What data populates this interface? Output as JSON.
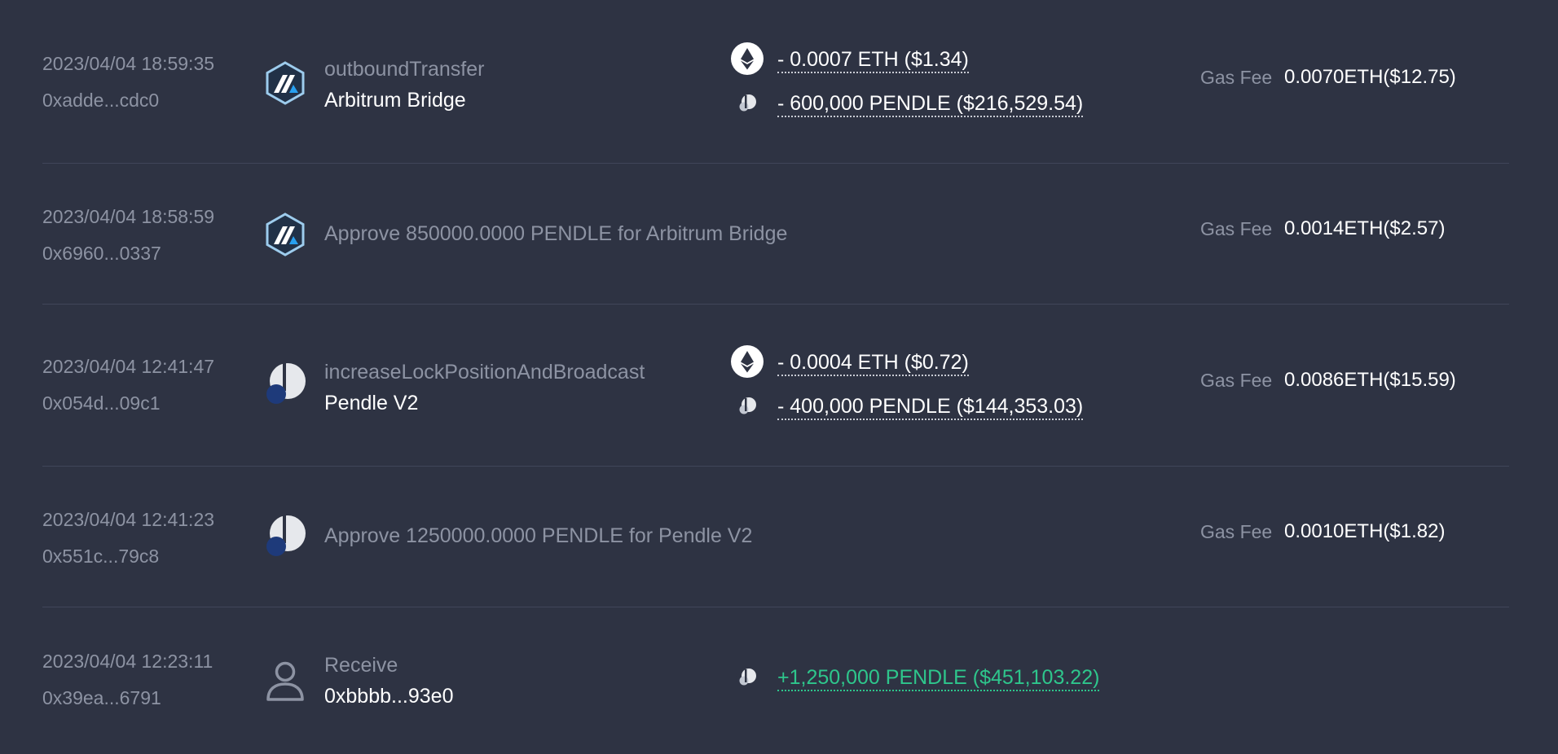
{
  "transactions": [
    {
      "time": "2023/04/04 18:59:35",
      "hash": "0xadde...cdc0",
      "icon": "arbitrum-logo",
      "method": "outboundTransfer",
      "project": "Arbitrum Bridge",
      "amounts": [
        {
          "token_icon": "eth-icon",
          "text": "- 0.0007 ETH ($1.34)"
        },
        {
          "token_icon": "pendle-icon",
          "text": "- 600,000 PENDLE ($216,529.54)"
        }
      ],
      "gas_label": "Gas Fee",
      "gas_value": "0.0070ETH($12.75)"
    },
    {
      "time": "2023/04/04 18:58:59",
      "hash": "0x6960...0337",
      "icon": "arbitrum-logo",
      "approve": "Approve 850000.0000 PENDLE for Arbitrum Bridge",
      "gas_label": "Gas Fee",
      "gas_value": "0.0014ETH($2.57)"
    },
    {
      "time": "2023/04/04 12:41:47",
      "hash": "0x054d...09c1",
      "icon": "pendle-logo",
      "method": "increaseLockPositionAndBroadcast",
      "project": "Pendle V2",
      "amounts": [
        {
          "token_icon": "eth-icon",
          "text": "- 0.0004 ETH ($0.72)"
        },
        {
          "token_icon": "pendle-icon",
          "text": "- 400,000 PENDLE ($144,353.03)"
        }
      ],
      "gas_label": "Gas Fee",
      "gas_value": "0.0086ETH($15.59)"
    },
    {
      "time": "2023/04/04 12:41:23",
      "hash": "0x551c...79c8",
      "icon": "pendle-logo",
      "approve": "Approve 1250000.0000 PENDLE for Pendle V2",
      "gas_label": "Gas Fee",
      "gas_value": "0.0010ETH($1.82)"
    },
    {
      "time": "2023/04/04 12:23:11",
      "hash": "0x39ea...6791",
      "icon": "user-icon",
      "method": "Receive",
      "project": "0xbbbb...93e0",
      "amounts": [
        {
          "token_icon": "pendle-icon",
          "text": "+1,250,000 PENDLE ($451,103.22)",
          "positive": true
        }
      ]
    }
  ],
  "colors": {
    "background": "#2e3343",
    "muted_text": "#8d93a3",
    "positive": "#2ec68c",
    "arbitrum_blue": "#28a0f0"
  }
}
